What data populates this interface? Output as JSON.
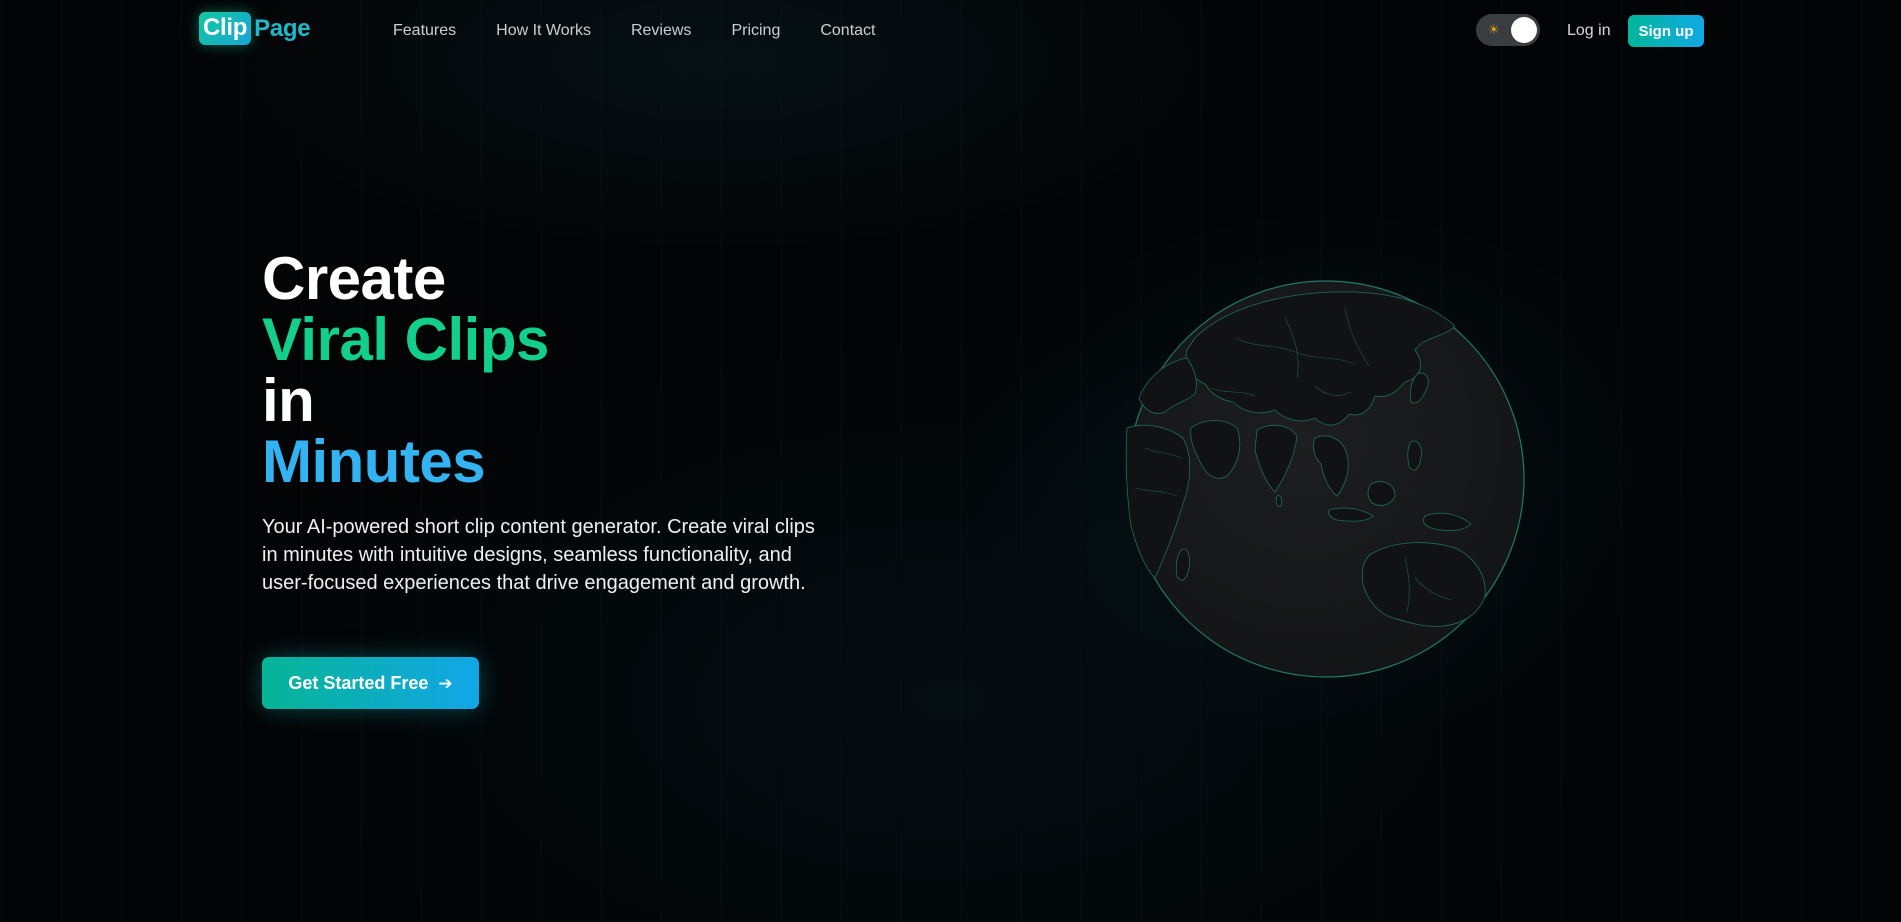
{
  "nav": {
    "logo_part1": "Clip",
    "logo_part2": "Page",
    "links": [
      "Features",
      "How It Works",
      "Reviews",
      "Pricing",
      "Contact"
    ],
    "theme_icon": "sun-icon",
    "login_label": "Log in",
    "signup_label": "Sign up"
  },
  "hero": {
    "title_line1": "Create",
    "title_line2": "Viral Clips",
    "title_line3": "in",
    "title_line4": "Minutes",
    "description": "Your AI-powered short clip content generator. Create viral clips in minutes with intuitive designs, seamless functionality, and user-focused experiences that drive engagement and growth.",
    "cta_label": "Get Started Free",
    "cta_icon": "arrow-right-icon"
  },
  "colors": {
    "background": "#030405",
    "accent_green": "#12d08c",
    "accent_blue": "#34b3f3",
    "button_gradient_start": "#06b595",
    "button_gradient_end": "#12a6e8",
    "globe_fill": "#191a1b",
    "globe_outline": "#1f7a66"
  }
}
